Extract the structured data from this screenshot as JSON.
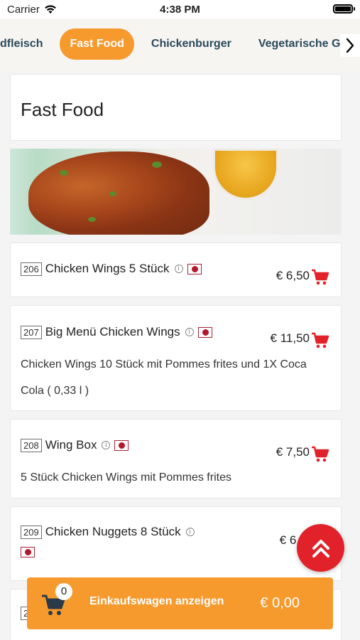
{
  "status_bar": {
    "carrier": "Carrier",
    "time": "4:38 PM"
  },
  "categories": {
    "items": [
      "dfleisch",
      "Fast Food",
      "Chickenburger",
      "Vegetarische Ge"
    ],
    "active": "Fast Food",
    "next_icon": "chevron-right-icon"
  },
  "page": {
    "title": "Fast Food"
  },
  "menu_items": [
    {
      "number": "206",
      "name": "Chicken Wings 5 Stück",
      "price": "€ 6,50",
      "description": ""
    },
    {
      "number": "207",
      "name": "Big Menü Chicken Wings",
      "price": "€ 11,50",
      "description": "Chicken Wings 10 Stück mit Pommes frites und 1X Coca Cola ( 0,33 l )"
    },
    {
      "number": "208",
      "name": "Wing Box",
      "price": "€ 7,50",
      "description": "5 Stück Chicken Wings mit Pommes frites"
    },
    {
      "number": "209",
      "name": "Chicken Nuggets 8 Stück",
      "price": "€ 6,",
      "description": ""
    },
    {
      "number": "2",
      "name": "",
      "price": "",
      "description": ""
    }
  ],
  "cart": {
    "count": "0",
    "label": "Einkaufswagen anzeigen",
    "total": "€ 0,00"
  },
  "colors": {
    "accent": "#f79a2d",
    "cart_icon": "#e1222a",
    "tab_text": "#2b4a5b"
  },
  "icons": {
    "info": "info-icon",
    "flag": "flag-icon",
    "cart": "cart-icon",
    "scroll_top": "double-chevron-up-icon"
  }
}
